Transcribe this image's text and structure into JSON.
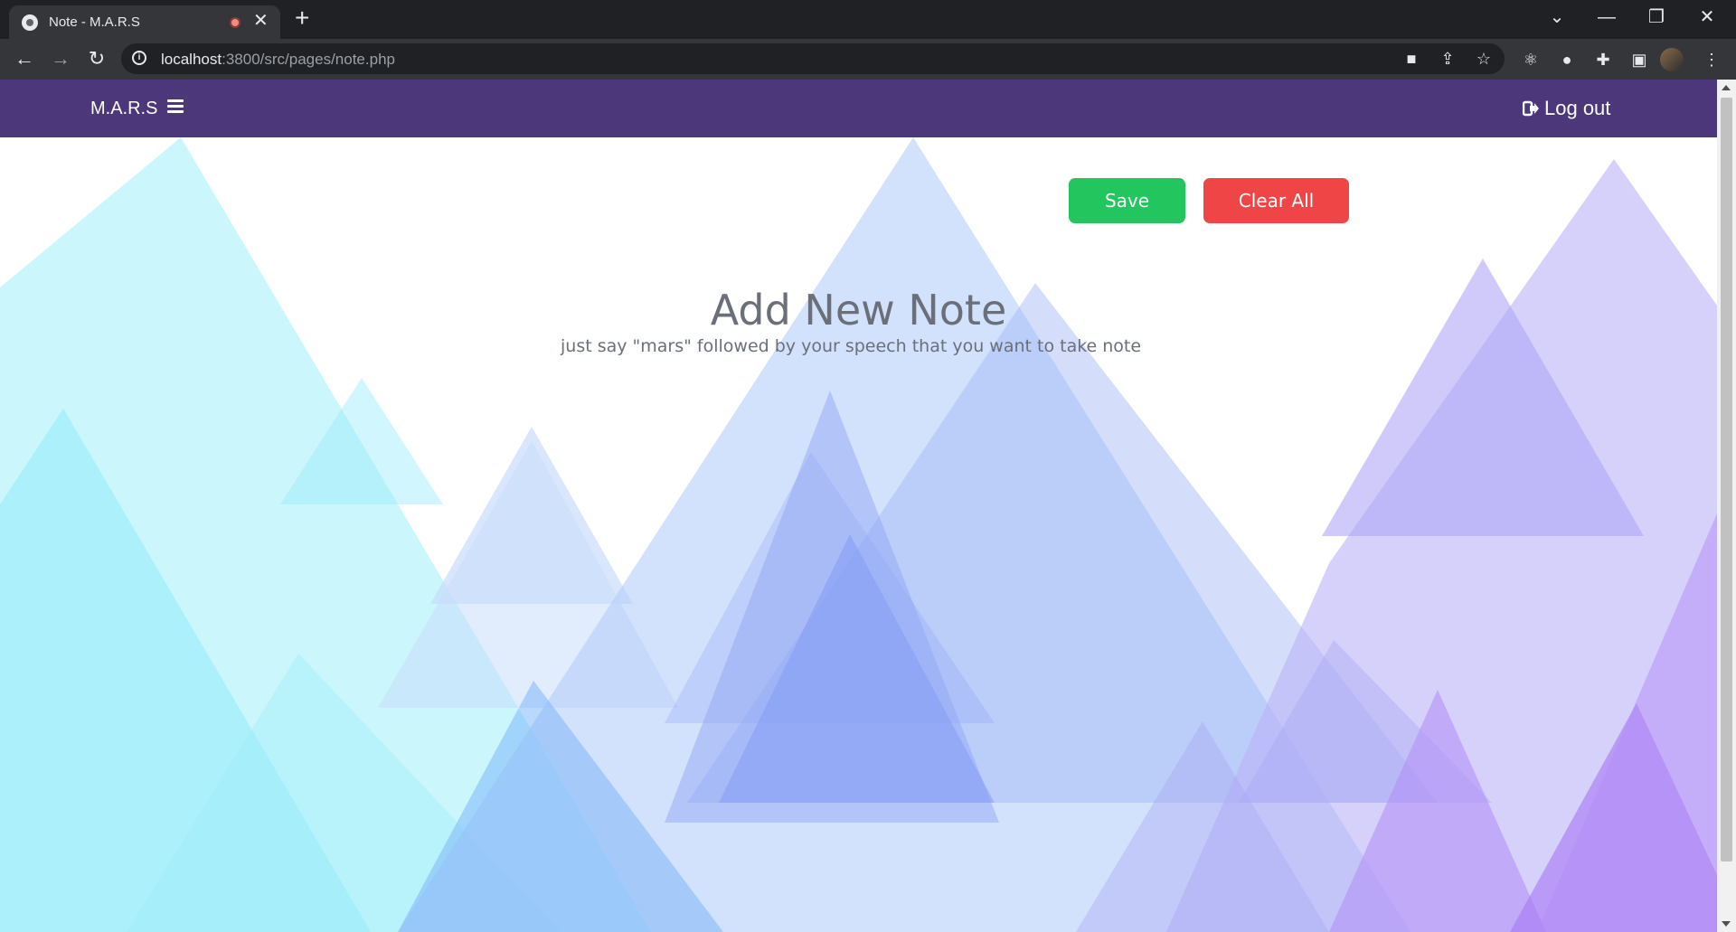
{
  "browser": {
    "tab_title": "Note - M.A.R.S",
    "url_host": "localhost",
    "url_rest": ":3800/src/pages/note.php",
    "new_tab_symbol": "+",
    "close_symbol": "✕"
  },
  "navbar": {
    "brand": "M.A.R.S",
    "logout_label": "Log out"
  },
  "actions": {
    "save_label": "Save",
    "clear_label": "Clear All"
  },
  "content": {
    "title": "Add New Note",
    "subtitle": "just say \"mars\" followed by your speech that you want to take note"
  },
  "colors": {
    "navbar": "#4b3779",
    "save": "#23c55e",
    "clear": "#ef4547",
    "heading": "#6b6f7a"
  },
  "icons": [
    "back-icon",
    "forward-icon",
    "reload-icon",
    "info-icon",
    "camera-icon",
    "share-icon",
    "star-icon",
    "react-devtools-icon",
    "extension-icon",
    "puzzle-icon",
    "sidepanel-icon",
    "more-icon",
    "hamburger-icon",
    "logout-icon"
  ]
}
